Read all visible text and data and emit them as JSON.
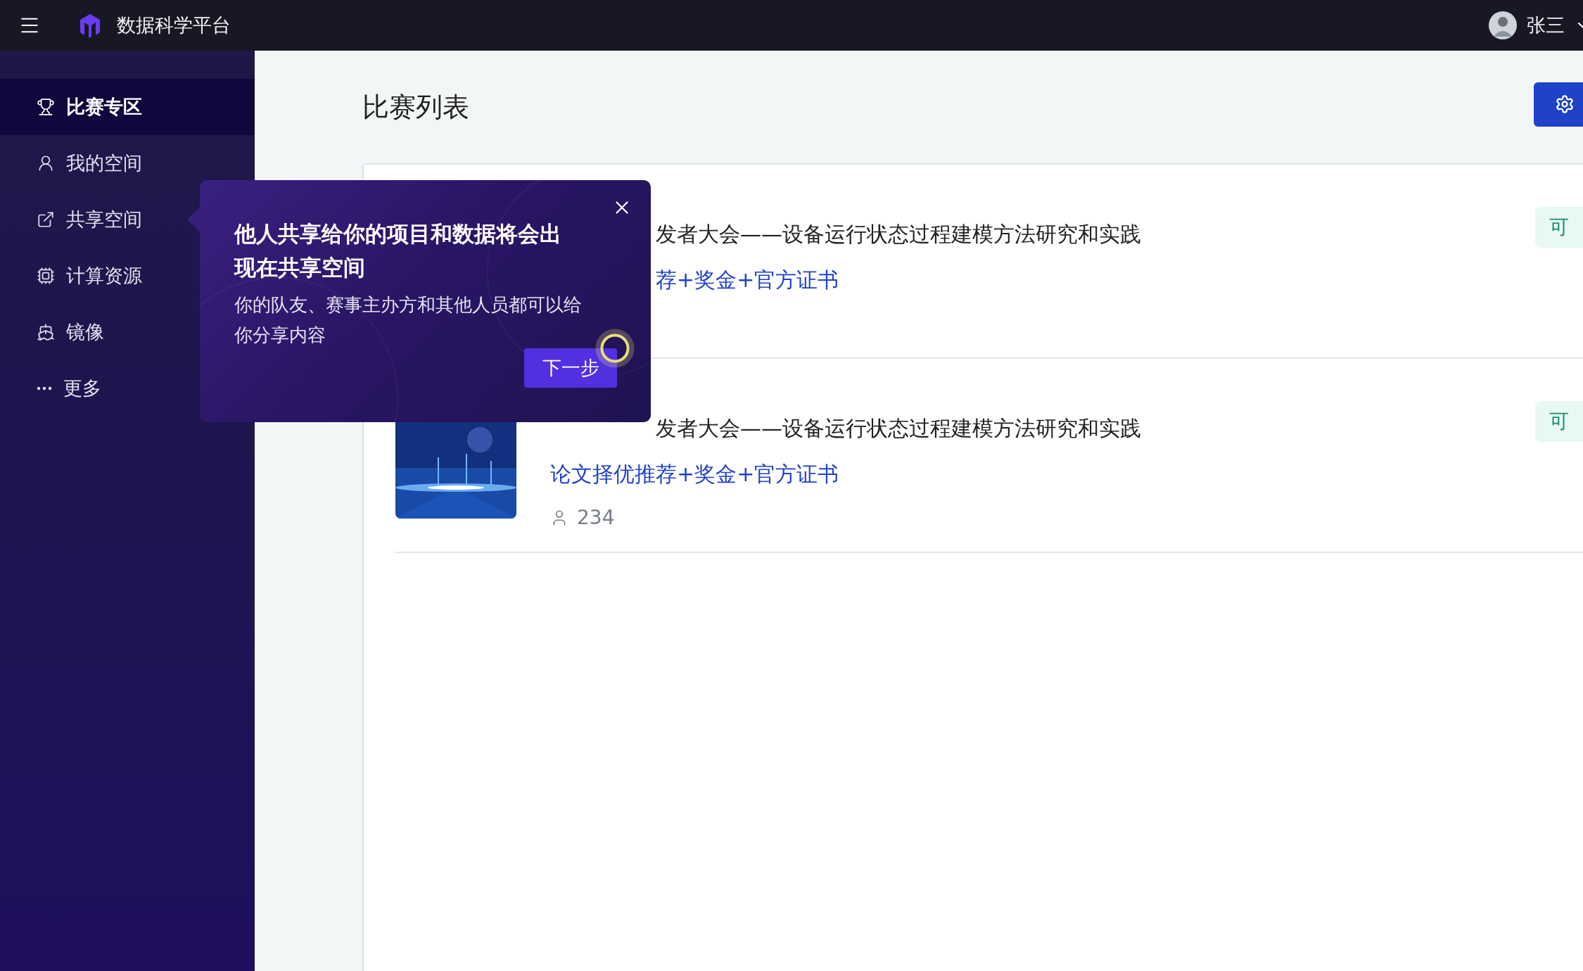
{
  "top_bar": {
    "app_title": "数据科学平台",
    "user_name": "张三"
  },
  "sidebar": {
    "items": [
      {
        "label": "比赛专区",
        "selected": true
      },
      {
        "label": "我的空间",
        "selected": false
      },
      {
        "label": "共享空间",
        "selected": false
      },
      {
        "label": "计算资源",
        "selected": false
      },
      {
        "label": "镜像",
        "selected": false
      },
      {
        "label": "更多",
        "selected": false
      }
    ]
  },
  "main": {
    "title": "比赛列表",
    "competitions": [
      {
        "title": "发者大会——设备运行状态过程建模方法研究和实践",
        "title_covered": true,
        "reward": "荐+奖金+官方证书",
        "reward_covered": true,
        "tag": "可"
      },
      {
        "title": "发者大会——设备运行状态过程建模方法研究和实践",
        "title_covered": true,
        "reward": "论文择优推荐+奖金+官方证书",
        "reward_covered": false,
        "participants": "234",
        "tag": "可"
      }
    ]
  },
  "guide_popup": {
    "title": "他人共享给你的项目和数据将会出现在共享空间",
    "body": "你的队友、赛事主办方和其他人员都可以给你分享内容",
    "next_button": "下一步"
  }
}
